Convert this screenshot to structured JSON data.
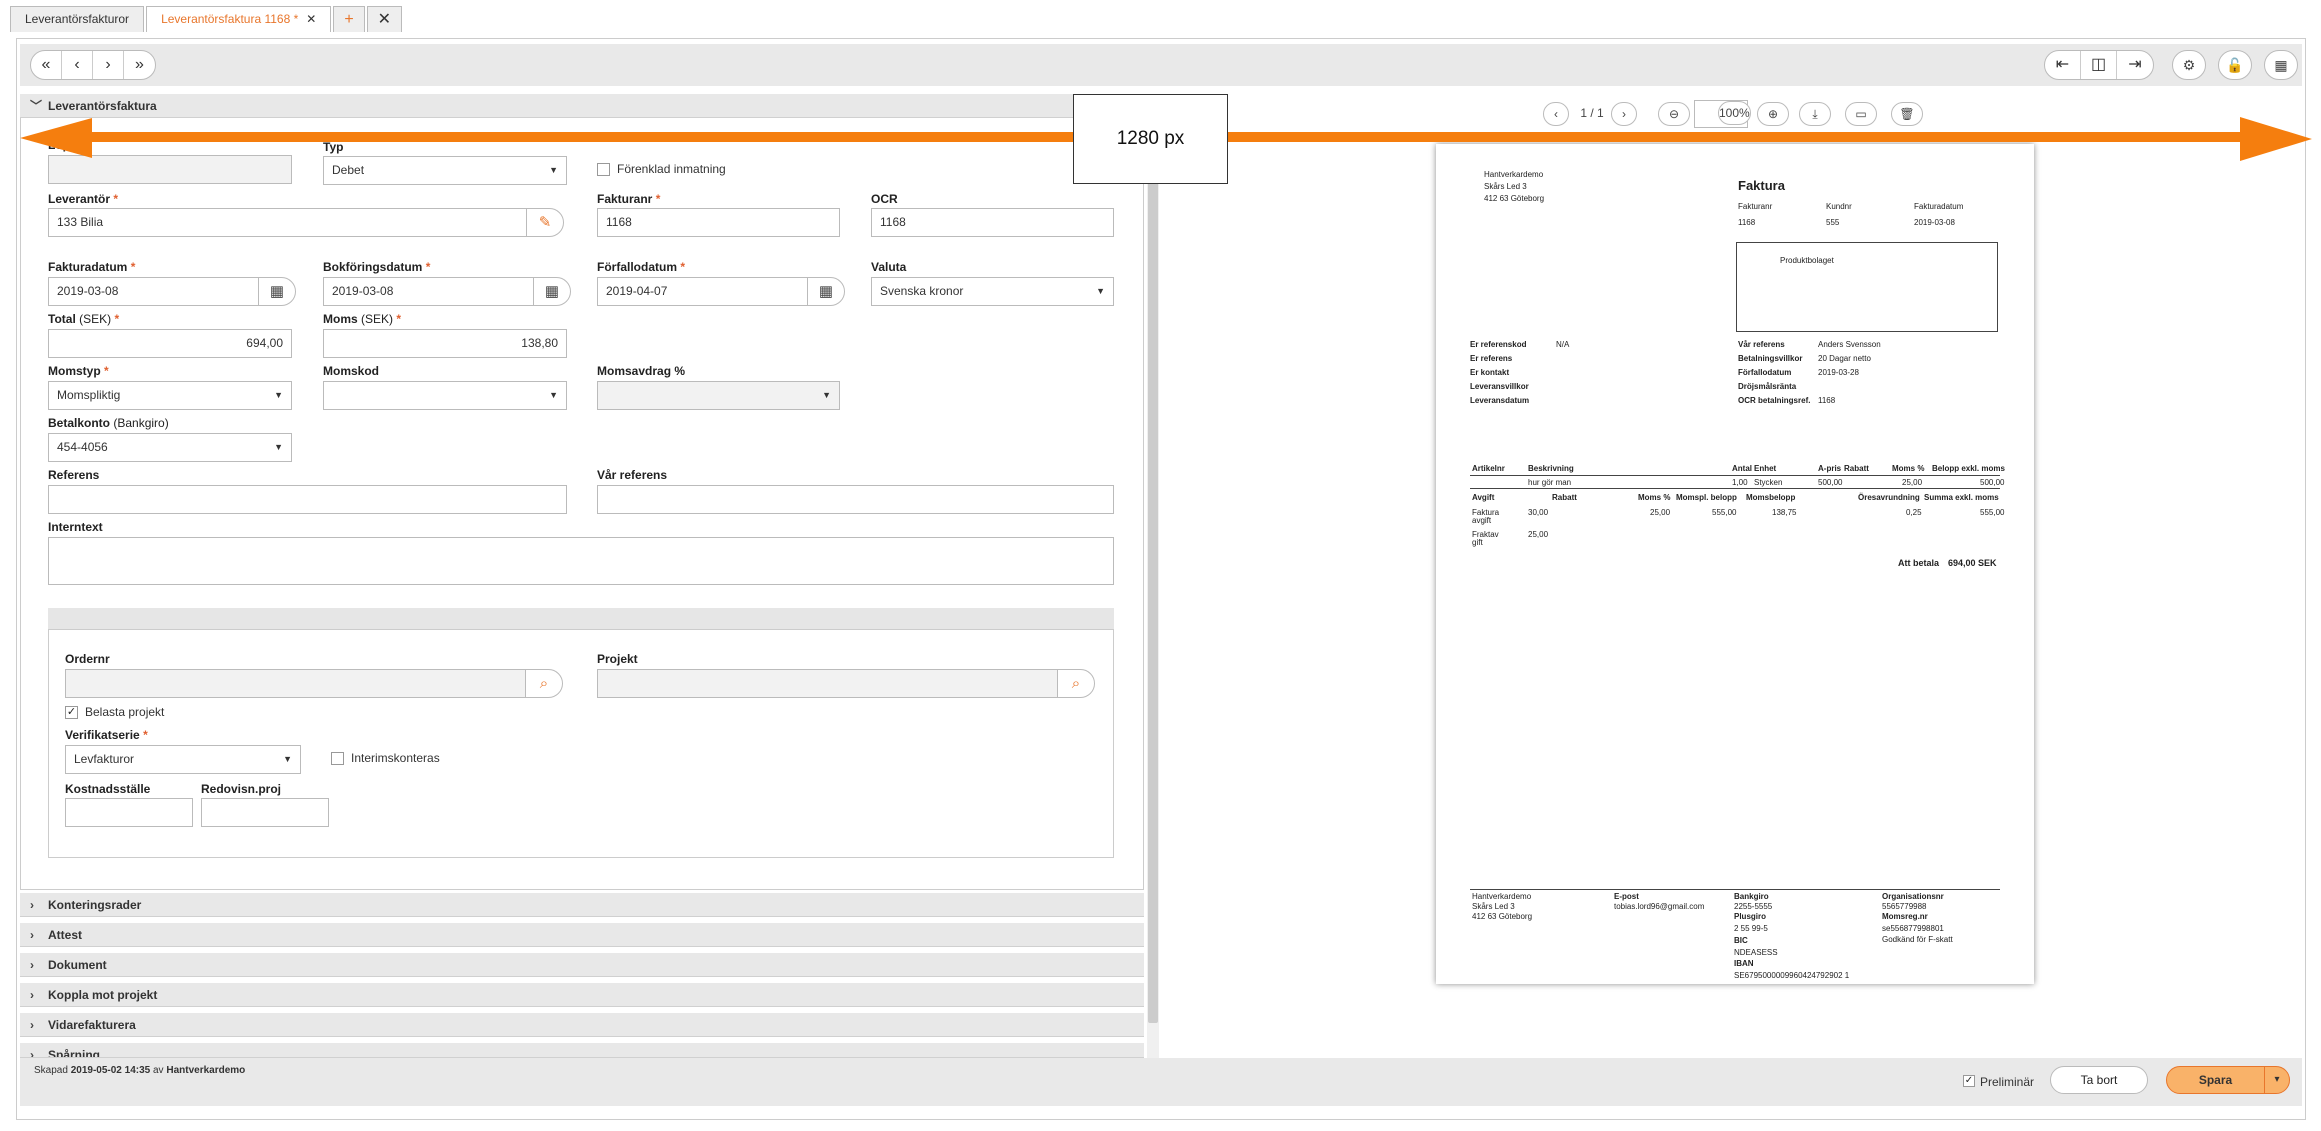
{
  "tabs": [
    {
      "label": "Leverantörsfakturor"
    },
    {
      "label": "Leverantörsfaktura 1168 *",
      "close": "✕"
    }
  ],
  "tab_add": "+",
  "tab_close_all": "✕",
  "nav": {
    "first": "«",
    "prev": "‹",
    "next": "›",
    "last": "»"
  },
  "section_title": "Leverantörsfaktura",
  "form": {
    "lopnr_label": "Löpnr",
    "typ_label": "Typ",
    "typ_value": "Debet",
    "forenklad": "Förenklad inmatning",
    "leverantor_label": "Leverantör",
    "leverantor_value": "133 Bilia",
    "fakturanr_label": "Fakturanr",
    "fakturanr_value": "1168",
    "ocr_label": "OCR",
    "ocr_value": "1168",
    "fakturadatum_label": "Fakturadatum",
    "fakturadatum_value": "2019-03-08",
    "bokforing_label": "Bokföringsdatum",
    "bokforing_value": "2019-03-08",
    "forfallo_label": "Förfallodatum",
    "forfallo_value": "2019-04-07",
    "valuta_label": "Valuta",
    "valuta_value": "Svenska kronor",
    "total_label": "Total",
    "total_sub": "(SEK)",
    "total_value": "694,00",
    "moms_label": "Moms",
    "moms_sub": "(SEK)",
    "moms_value": "138,80",
    "momstyp_label": "Momstyp",
    "momstyp_value": "Momspliktig",
    "momskod_label": "Momskod",
    "momsavdrag_label": "Momsavdrag %",
    "betalkonto_label": "Betalkonto",
    "betalkonto_sub": "(Bankgiro)",
    "betalkonto_value": "454-4056",
    "referens_label": "Referens",
    "var_referens_label": "Vår referens",
    "internt_label": "Interntext",
    "ordernr_label": "Ordernr",
    "projekt_label": "Projekt",
    "belasta_label": "Belasta projekt",
    "verifikat_label": "Verifikatserie",
    "verifikat_value": "Levfakturor",
    "interims_label": "Interimskonteras",
    "kostnad_label": "Kostnadsställe",
    "redovisn_label": "Redovisn.proj",
    "req": "*"
  },
  "sections": [
    "Konteringsrader",
    "Attest",
    "Dokument",
    "Koppla mot projekt",
    "Vidarefakturera",
    "Spårning"
  ],
  "footer": {
    "skapad": "Skapad",
    "date": "2019-05-02 14:35",
    "av": "av",
    "user": "Hantverkardemo",
    "preliminar": "Preliminär",
    "delete": "Ta bort",
    "save": "Spara",
    "save_arrow": "▾"
  },
  "pdf": {
    "page": "1 / 1",
    "zoom": "100%"
  },
  "overlay": {
    "label": "1280 px"
  },
  "invoice": {
    "company": "Hantverkardemo",
    "addr1": "Skårs Led 3",
    "addr2": "412 63 Göteborg",
    "title": "Faktura",
    "h_fakturanr": "Fakturanr",
    "h_kundnr": "Kundnr",
    "h_fakturadatum": "Fakturadatum",
    "v_fakturanr": "1168",
    "v_kundnr": "555",
    "v_fakturadatum": "2019-03-08",
    "recipient": "Produktbolaget",
    "left_keys": [
      "Er referenskod",
      "Er referens",
      "Er kontakt",
      "Leveransvillkor",
      "Leveransdatum"
    ],
    "left_vals": [
      "N/A",
      "",
      "",
      "",
      ""
    ],
    "right_keys": [
      "Vår referens",
      "Betalningsvillkor",
      "Förfallodatum",
      "Dröjsmålsränta",
      "OCR betalningsref."
    ],
    "right_vals": [
      "Anders Svensson",
      "20 Dagar netto",
      "2019-03-28",
      "",
      "1168"
    ],
    "cols": [
      "Artikelnr",
      "Beskrivning",
      "Antal",
      "Enhet",
      "A-pris",
      "Rabatt",
      "Moms %",
      "Belopp exkl. moms"
    ],
    "row": [
      "hur gör man",
      "1,00",
      "Stycken",
      "500,00",
      "25,00",
      "500,00"
    ],
    "cols2": [
      "Avgift",
      "Rabatt",
      "Moms %",
      "Momspl. belopp",
      "Momsbelopp",
      "Öresavrundning",
      "Summa exkl. moms"
    ],
    "fee1": [
      "Faktura",
      "avgift",
      "30,00",
      "25,00",
      "555,00",
      "138,75",
      "0,25",
      "555,00"
    ],
    "fee2": [
      "Fraktav",
      "gift",
      "25,00"
    ],
    "att_betala": "Att betala",
    "total": "694,00 SEK",
    "f_col1": [
      "Hantverkardemo",
      "Skårs Led 3",
      "412 63 Göteborg"
    ],
    "f_epost_h": "E-post",
    "f_epost": "tobias.lord96@gmail.com",
    "f_bank_h": "Bankgiro",
    "f_bank": "2255-5555",
    "f_plus_h": "Plusgiro",
    "f_plus": "2 55 99-5",
    "f_bic_h": "BIC",
    "f_bic": "NDEASESS",
    "f_iban_h": "IBAN",
    "f_iban": "SE6795000009960424792902 1",
    "f_org_h": "Organisationsnr",
    "f_org": "5565779988",
    "f_moms_h": "Momsreg.nr",
    "f_moms": "se556877998801",
    "f_fskatt": "Godkänd för F-skatt"
  }
}
